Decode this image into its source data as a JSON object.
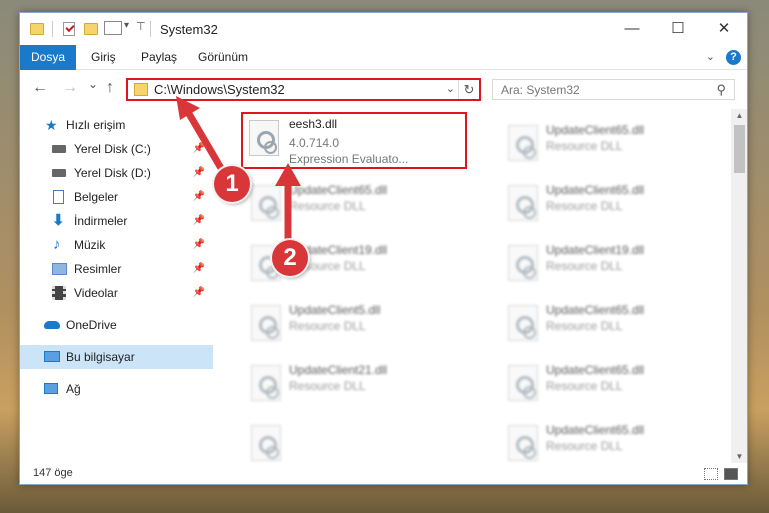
{
  "window": {
    "title": "System32",
    "controls": {
      "minimize": "—",
      "maximize": "☐",
      "close": "✕"
    }
  },
  "ribbon": {
    "tabs": [
      "Dosya",
      "Giriş",
      "Paylaş",
      "Görünüm"
    ],
    "expand_icon": "chevron-down-icon",
    "help_label": "?"
  },
  "nav": {
    "back": "←",
    "forward": "→",
    "recent": "⌄",
    "up": "↑",
    "address": "C:\\Windows\\System32",
    "refresh": "↻",
    "search_placeholder": "Ara: System32"
  },
  "sidebar": {
    "items": [
      {
        "label": "Hızlı erişim",
        "icon": "star-icon",
        "pinned": false,
        "color": "#1979ca"
      },
      {
        "label": "Yerel Disk (C:)",
        "icon": "drive-icon",
        "pinned": true,
        "color": "#555555"
      },
      {
        "label": "Yerel Disk (D:)",
        "icon": "drive-icon",
        "pinned": true,
        "color": "#555555"
      },
      {
        "label": "Belgeler",
        "icon": "documents-icon",
        "pinned": true,
        "color": "#4a7bb8"
      },
      {
        "label": "İndirmeler",
        "icon": "download-icon",
        "pinned": true,
        "color": "#1979ca"
      },
      {
        "label": "Müzik",
        "icon": "music-icon",
        "pinned": true,
        "color": "#1979ca"
      },
      {
        "label": "Resimler",
        "icon": "pictures-icon",
        "pinned": true,
        "color": "#5a8bc8"
      },
      {
        "label": "Videolar",
        "icon": "videos-icon",
        "pinned": true,
        "color": "#555555"
      },
      {
        "label": "OneDrive",
        "icon": "cloud-icon",
        "pinned": false,
        "color": "#1979ca"
      },
      {
        "label": "Bu bilgisayar",
        "icon": "computer-icon",
        "pinned": false,
        "color": "#1979ca",
        "selected": true
      },
      {
        "label": "Ağ",
        "icon": "network-icon",
        "pinned": false,
        "color": "#1979ca"
      }
    ]
  },
  "files": {
    "highlighted": {
      "name": "eesh3.dll",
      "version": "4.0.714.0",
      "description": "Expression Evaluato..."
    },
    "left_column": [
      {
        "name": "UpdateClient65.dll",
        "description": "Resource DLL"
      },
      {
        "name": "UpdateClient19.dll",
        "description": "Resource DLL"
      },
      {
        "name": "UpdateClient5.dll",
        "description": "Resource DLL"
      },
      {
        "name": "UpdateClient21.dll",
        "description": "Resource DLL"
      },
      {
        "name": "",
        "description": ""
      }
    ],
    "right_column": [
      {
        "name": "UpdateClient65.dll",
        "description": "Resource DLL"
      },
      {
        "name": "UpdateClient65.dll",
        "description": "Resource DLL"
      },
      {
        "name": "UpdateClient19.dll",
        "description": "Resource DLL"
      },
      {
        "name": "UpdateClient65.dll",
        "description": "Resource DLL"
      },
      {
        "name": "UpdateClient65.dll",
        "description": "Resource DLL"
      },
      {
        "name": "UpdateClient65.dll",
        "description": "Resource DLL"
      },
      {
        "name": "",
        "description": ""
      }
    ]
  },
  "status": {
    "item_count": "147 öge"
  },
  "annotations": {
    "step1": "1",
    "step2": "2",
    "color": "#d9363a"
  }
}
